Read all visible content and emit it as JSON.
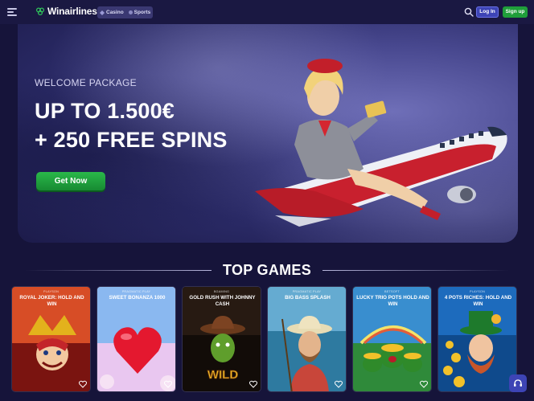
{
  "header": {
    "brand": "Winairlines",
    "nav_casino": "Casino",
    "nav_sports": "Sports",
    "login_label": "Log In",
    "signup_label": "Sign up"
  },
  "hero": {
    "subtitle": "WELCOME PACKAGE",
    "line1": "UP TO 1.500€",
    "line2": "+ 250 FREE SPINS",
    "cta_label": "Get Now"
  },
  "section": {
    "title": "TOP GAMES"
  },
  "games": [
    {
      "provider": "PLAYSON",
      "name": "ROYAL JOKER: HOLD AND WIN",
      "bg_top": "#e8572a",
      "bg_bottom": "#7a1410"
    },
    {
      "provider": "PRAGMATIC PLAY",
      "name": "SWEET BONANZA 1000",
      "bg_top": "#7fb6ef",
      "bg_bottom": "#e9c7f0"
    },
    {
      "provider": "BGAMING",
      "name": "GOLD RUSH WITH JOHNNY CASH",
      "bg_top": "#2a1c14",
      "bg_bottom": "#120c08"
    },
    {
      "provider": "PRAGMATIC PLAY",
      "name": "BIG BASS SPLASH",
      "bg_top": "#6fb4d9",
      "bg_bottom": "#2e7aa0"
    },
    {
      "provider": "BETSOFT",
      "name": "LUCKY TRIO POTS HOLD AND WIN",
      "bg_top": "#3b8ee0",
      "bg_bottom": "#2f8a3a"
    },
    {
      "provider": "PLAYSON",
      "name": "4 POTS RICHES: HOLD AND WIN",
      "bg_top": "#1f6fc2",
      "bg_bottom": "#0f4a8c"
    }
  ],
  "colors": {
    "background": "#16143a",
    "header": "#1a1842",
    "login": "#3d44b5",
    "signup": "#1f9e3a",
    "cta": "#2ab84a"
  }
}
